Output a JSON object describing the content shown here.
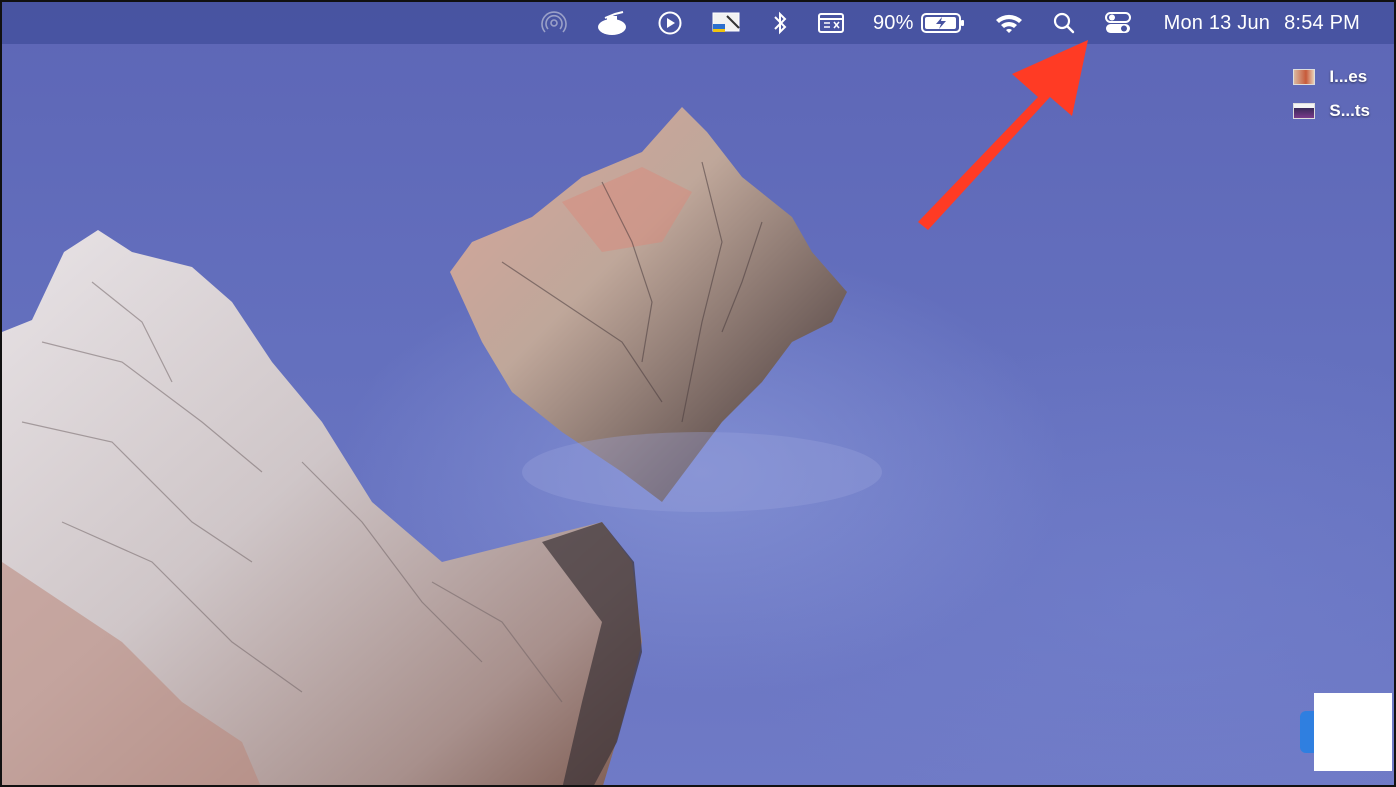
{
  "menubar": {
    "battery_percent": "90%",
    "date": "Mon 13 Jun",
    "time": "8:54 PM",
    "icons": [
      "airdrop-icon",
      "app-status-icon",
      "play-icon",
      "display-app-icon",
      "bluetooth-icon",
      "window-app-icon",
      "battery-icon",
      "wifi-icon",
      "search-icon",
      "control-center-icon"
    ]
  },
  "desktop": {
    "items": [
      {
        "label": "I...es",
        "icon": "image-file-icon"
      },
      {
        "label": "S...ts",
        "icon": "screenshot-file-icon"
      }
    ]
  },
  "annotation": {
    "arrow_color": "#ff3b24"
  },
  "colors": {
    "wallpaper": "#6470be",
    "menubar": "#4652a0"
  }
}
